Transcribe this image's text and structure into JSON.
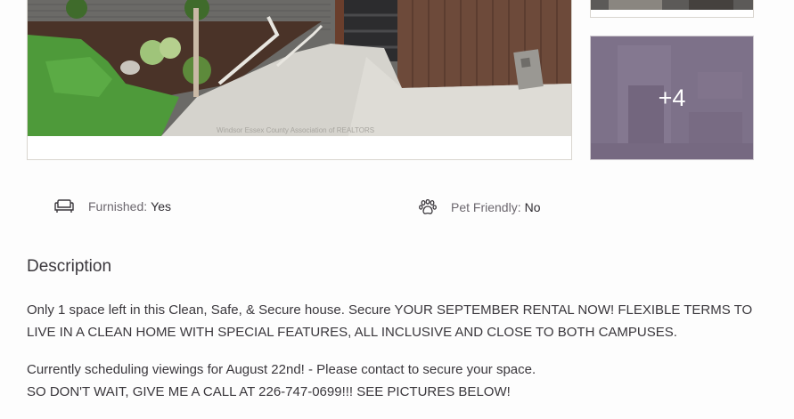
{
  "gallery": {
    "watermark": "Windsor Essex County Association of REALTORS",
    "more_count": "+4"
  },
  "features": [
    {
      "icon": "sofa-icon",
      "label": "Furnished:",
      "value": "Yes"
    },
    {
      "icon": "paw-icon",
      "label": "Pet Friendly:",
      "value": "No"
    }
  ],
  "description": {
    "title": "Description",
    "paragraphs": [
      "Only 1 space left in this Clean, Safe, & Secure house. Secure YOUR SEPTEMBER RENTAL NOW! FLEXIBLE TERMS TO LIVE IN A CLEAN HOME WITH SPECIAL FEATURES, ALL INCLUSIVE AND CLOSE TO BOTH CAMPUSES.",
      "Currently scheduling viewings for August 22nd! - Please contact to secure your space.",
      "SO DON'T WAIT, GIVE ME A CALL AT 226-747-0699!!! SEE PICTURES BELOW!"
    ]
  }
}
